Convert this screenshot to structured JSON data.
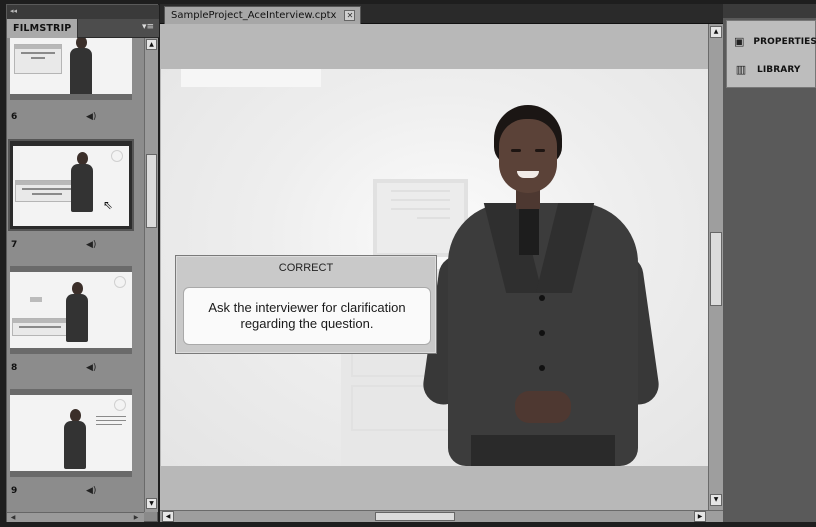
{
  "filmstrip": {
    "title": "FILMSTRIP",
    "menu_icon": "panel-menu-icon",
    "slides": [
      {
        "number": "6",
        "audio_icon": "speaker-icon",
        "selected": false
      },
      {
        "number": "7",
        "audio_icon": "speaker-icon",
        "selected": true
      },
      {
        "number": "8",
        "audio_icon": "speaker-icon",
        "selected": false
      },
      {
        "number": "9",
        "audio_icon": "speaker-icon",
        "selected": false
      }
    ]
  },
  "document": {
    "tab_label": "SampleProject_AceInterview.cptx",
    "close_icon": "close-icon"
  },
  "stage": {
    "feedback_title": "CORRECT",
    "feedback_text": "Ask the interviewer for clarification regarding the question."
  },
  "right_panel": {
    "items": [
      {
        "label": "PROPERTIES",
        "icon": "properties-icon"
      },
      {
        "label": "LIBRARY",
        "icon": "library-icon"
      }
    ]
  },
  "colors": {
    "panel_bg": "#8a8a8a",
    "chrome_dark": "#1e1e1e",
    "stage_bg": "#efefef",
    "workspace_bg": "#b8b8b8"
  }
}
